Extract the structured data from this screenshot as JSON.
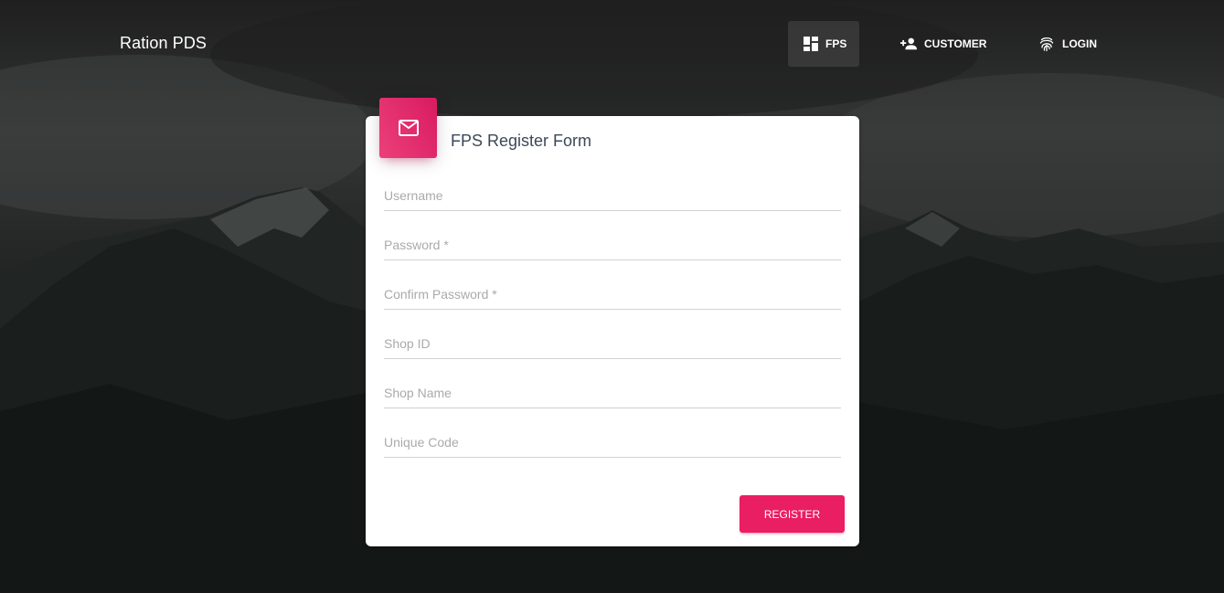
{
  "navbar": {
    "brand": "Ration PDS",
    "items": [
      {
        "label": "FPS",
        "icon": "dashboard-icon",
        "active": true
      },
      {
        "label": "CUSTOMER",
        "icon": "person-add-icon",
        "active": false
      },
      {
        "label": "LOGIN",
        "icon": "fingerprint-icon",
        "active": false
      }
    ]
  },
  "form": {
    "icon": "mail-icon",
    "title": "FPS Register Form",
    "fields": [
      {
        "placeholder": "Username",
        "value": ""
      },
      {
        "placeholder": "Password *",
        "value": ""
      },
      {
        "placeholder": "Confirm Password *",
        "value": ""
      },
      {
        "placeholder": "Shop ID",
        "value": ""
      },
      {
        "placeholder": "Shop Name",
        "value": ""
      },
      {
        "placeholder": "Unique Code",
        "value": ""
      }
    ],
    "submit_label": "REGISTER"
  },
  "colors": {
    "accent": "#e91e63",
    "card_background": "#ffffff",
    "title_text": "#3c4858",
    "placeholder_text": "#aaaaaa"
  }
}
